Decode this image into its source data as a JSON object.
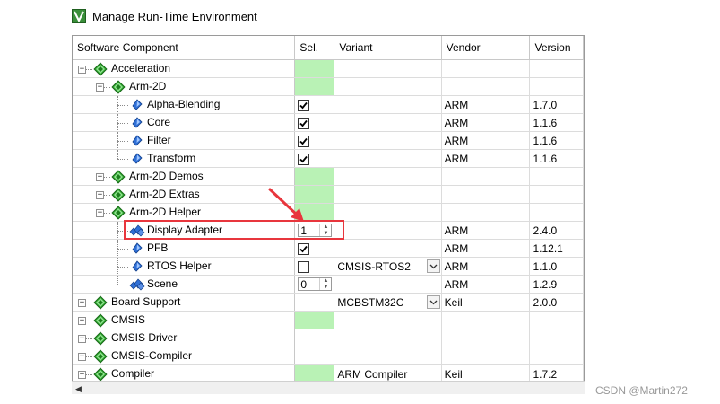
{
  "window": {
    "title": "Manage Run-Time Environment"
  },
  "columns": [
    "Software Component",
    "Sel.",
    "Variant",
    "Vendor",
    "Version"
  ],
  "rows": [
    {
      "level": 0,
      "expander": "-",
      "icon": "gem",
      "label": "Acceleration",
      "sel": "green",
      "variant": "",
      "vendor": "",
      "version": ""
    },
    {
      "level": 1,
      "expander": "-",
      "icon": "gem",
      "label": "Arm-2D",
      "sel": "green",
      "variant": "",
      "vendor": "",
      "version": ""
    },
    {
      "level": 2,
      "expander": "",
      "icon": "diamond",
      "label": "Alpha-Blending",
      "sel": "check",
      "variant": "",
      "vendor": "ARM",
      "version": "1.7.0"
    },
    {
      "level": 2,
      "expander": "",
      "icon": "diamond",
      "label": "Core",
      "sel": "check",
      "variant": "",
      "vendor": "ARM",
      "version": "1.1.6"
    },
    {
      "level": 2,
      "expander": "",
      "icon": "diamond",
      "label": "Filter",
      "sel": "check",
      "variant": "",
      "vendor": "ARM",
      "version": "1.1.6"
    },
    {
      "level": 2,
      "expander": "",
      "icon": "diamond",
      "label": "Transform",
      "sel": "check",
      "variant": "",
      "vendor": "ARM",
      "version": "1.1.6"
    },
    {
      "level": 1,
      "expander": "+",
      "icon": "gem",
      "label": "Arm-2D Demos",
      "sel": "green",
      "variant": "",
      "vendor": "",
      "version": ""
    },
    {
      "level": 1,
      "expander": "+",
      "icon": "gem",
      "label": "Arm-2D Extras",
      "sel": "green",
      "variant": "",
      "vendor": "",
      "version": ""
    },
    {
      "level": 1,
      "expander": "-",
      "icon": "gem",
      "label": "Arm-2D Helper",
      "sel": "green",
      "variant": "",
      "vendor": "",
      "version": ""
    },
    {
      "level": 2,
      "expander": "",
      "icon": "multi",
      "label": "Display Adapter",
      "sel": "spin",
      "spin_value": "1",
      "variant": "",
      "vendor": "ARM",
      "version": "2.4.0",
      "selected": true
    },
    {
      "level": 2,
      "expander": "",
      "icon": "diamond",
      "label": "PFB",
      "sel": "check",
      "variant": "",
      "vendor": "ARM",
      "version": "1.12.1"
    },
    {
      "level": 2,
      "expander": "",
      "icon": "diamond",
      "label": "RTOS Helper",
      "sel": "uncheck",
      "variant": "CMSIS-RTOS2",
      "variant_combo": true,
      "vendor": "ARM",
      "version": "1.1.0"
    },
    {
      "level": 2,
      "expander": "",
      "icon": "multi",
      "label": "Scene",
      "sel": "spin",
      "spin_value": "0",
      "variant": "",
      "vendor": "ARM",
      "version": "1.2.9",
      "last": true
    },
    {
      "level": 0,
      "expander": "+",
      "icon": "gem",
      "label": "Board Support",
      "sel": "",
      "variant": "MCBSTM32C",
      "variant_combo": true,
      "vendor": "Keil",
      "version": "2.0.0"
    },
    {
      "level": 0,
      "expander": "+",
      "icon": "gem",
      "label": "CMSIS",
      "sel": "green",
      "variant": "",
      "vendor": "",
      "version": ""
    },
    {
      "level": 0,
      "expander": "+",
      "icon": "gem",
      "label": "CMSIS Driver",
      "sel": "",
      "variant": "",
      "vendor": "",
      "version": ""
    },
    {
      "level": 0,
      "expander": "+",
      "icon": "gem",
      "label": "CMSIS-Compiler",
      "sel": "",
      "variant": "",
      "vendor": "",
      "version": ""
    },
    {
      "level": 0,
      "expander": "+",
      "icon": "gem",
      "label": "Compiler",
      "sel": "green",
      "variant": "ARM Compiler",
      "vendor": "Keil",
      "version": "1.7.2"
    }
  ],
  "watermark": "CSDN @Martin272",
  "colors": {
    "sel_green": "#b9f2b5",
    "highlight": "#e8363d",
    "gem_green": "#2a9d2a"
  }
}
